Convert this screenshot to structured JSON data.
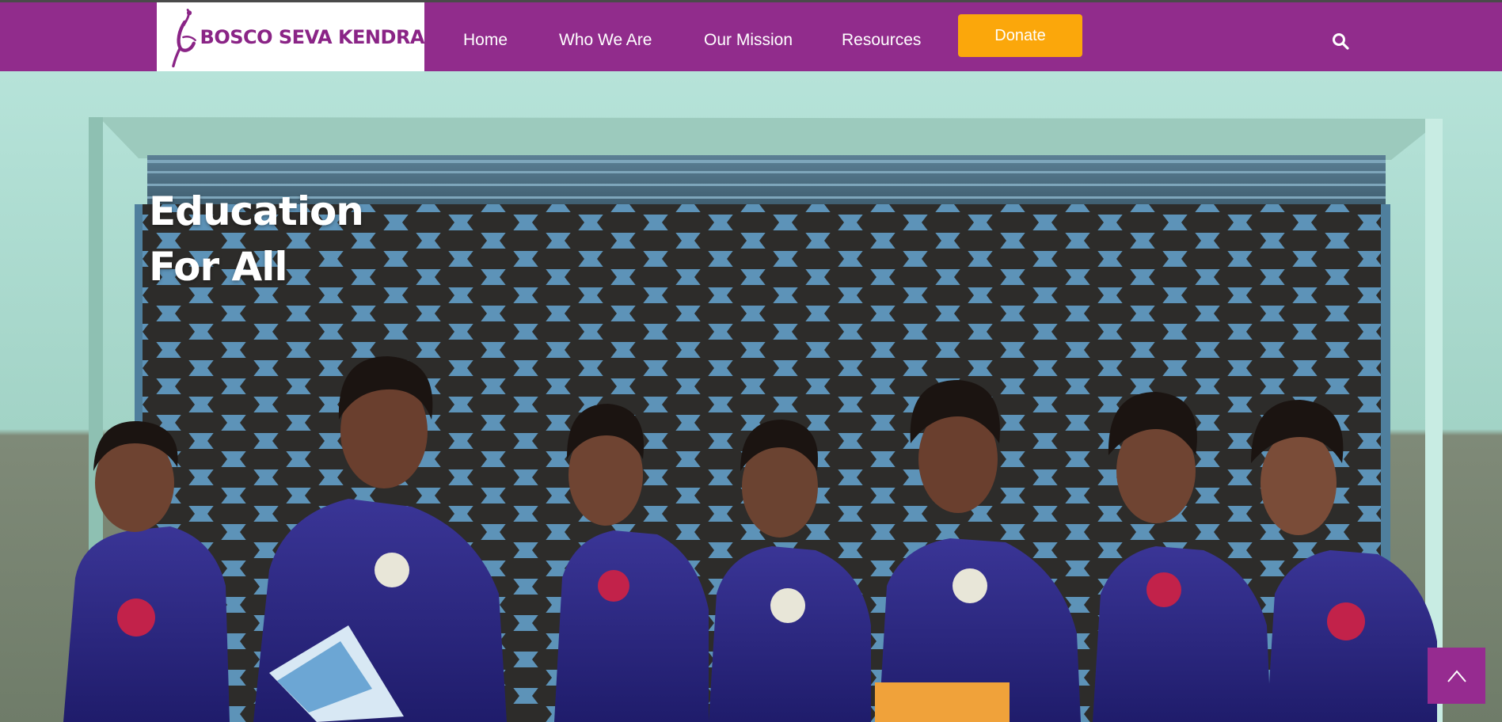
{
  "brand": {
    "name": "BOSCO SEVA KENDRA",
    "logo_icon": "dancing-figure-logo-icon",
    "color": "#8a2486"
  },
  "nav": {
    "items": [
      {
        "label": "Home"
      },
      {
        "label": "Who We Are"
      },
      {
        "label": "Our Mission"
      },
      {
        "label": "Resources"
      }
    ],
    "donate_label": "Donate",
    "search_icon": "search-icon"
  },
  "hero": {
    "title_line1": "Education",
    "title_line2": "For All"
  },
  "scroll_top": {
    "icon": "chevron-up-icon"
  },
  "colors": {
    "header_bg": "#912c8c",
    "donate_bg": "#fba70b",
    "scroll_top_bg": "#962b90"
  }
}
